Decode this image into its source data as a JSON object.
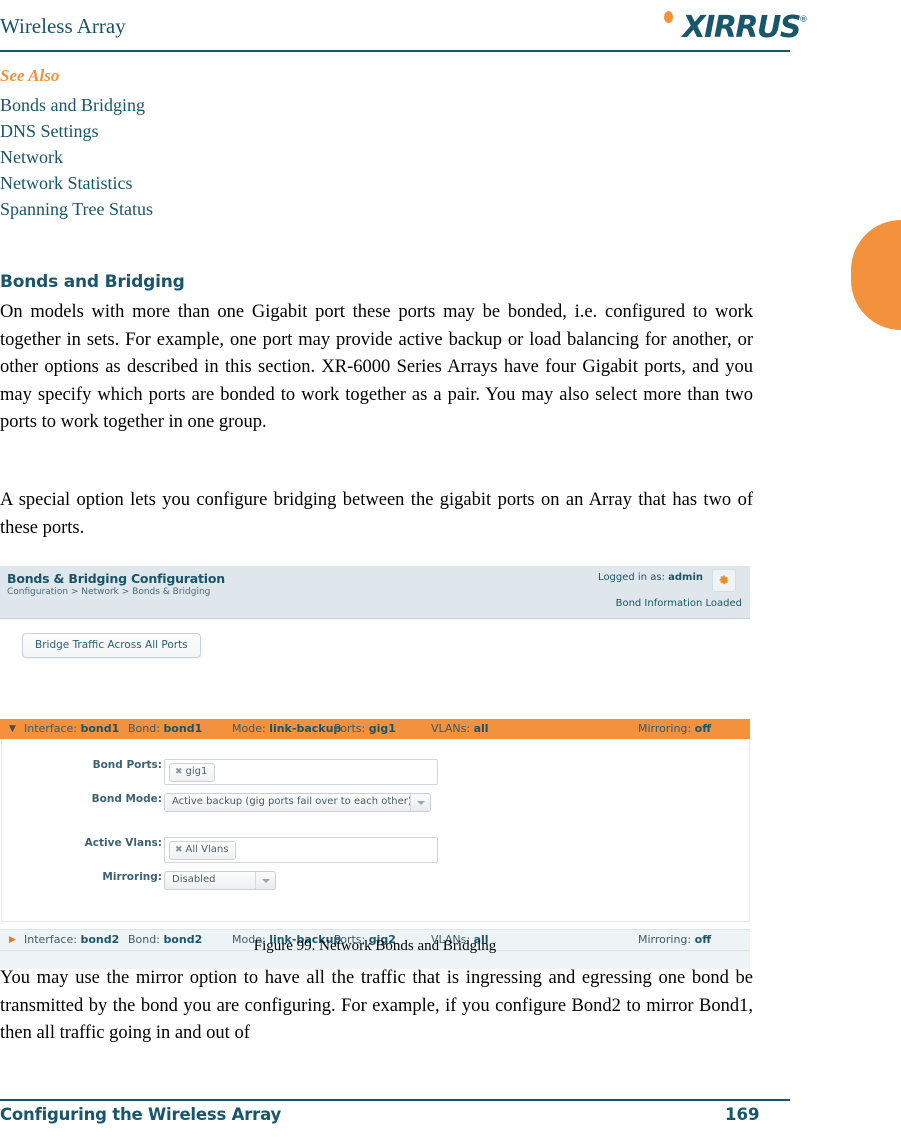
{
  "page_header": {
    "title": "Wireless Array",
    "logo_text": "XIRRUS",
    "logo_registered": "®"
  },
  "see_also": {
    "title": "See Also",
    "links": [
      "Bonds and Bridging",
      "DNS Settings",
      "Network",
      "Network Statistics",
      "Spanning Tree Status"
    ]
  },
  "section": {
    "heading": "Bonds and Bridging",
    "paragraph_1": "On models with more than one Gigabit port these ports may be bonded, i.e. configured to work together in sets. For example, one port may provide active backup or load balancing for another, or other options as described in this section. XR-6000 Series Arrays have four Gigabit ports, and you may specify which ports are bonded to work together as a pair. You may also select more than two ports to work together in one group.",
    "paragraph_2": "A special option lets you configure bridging between the gigabit ports on an Array that has two of these ports.",
    "paragraph_3": "You may use the mirror option to have all the traffic that is ingressing and egressing one bond be transmitted by the bond you are configuring. For example, if you configure Bond2 to mirror Bond1, then all traffic going in and out of"
  },
  "figure": {
    "caption": "Figure 99. Network Bonds and Bridging"
  },
  "ui": {
    "title": "Bonds & Bridging Configuration",
    "breadcrumb": "Configuration > Network > Bonds & Bridging",
    "logged_in_label": "Logged in as:",
    "logged_in_user": "admin",
    "gear_icon": "gear-icon",
    "status": "Bond Information Loaded",
    "bridge_button": "Bridge Traffic Across All Ports",
    "rows": [
      {
        "expanded": true,
        "triangle": "▼",
        "interface_label": "Interface:",
        "interface_value": "bond1",
        "bond_label": "Bond:",
        "bond_value": "bond1",
        "mode_label": "Mode:",
        "mode_value": "link-backup",
        "ports_label": "Ports:",
        "ports_value": "gig1",
        "vlans_label": "VLANs:",
        "vlans_value": "all",
        "mirroring_label": "Mirroring:",
        "mirroring_value": "off"
      },
      {
        "expanded": false,
        "triangle": "▶",
        "interface_label": "Interface:",
        "interface_value": "bond2",
        "bond_label": "Bond:",
        "bond_value": "bond2",
        "mode_label": "Mode:",
        "mode_value": "link-backup",
        "ports_label": "Ports:",
        "ports_value": "gig2",
        "vlans_label": "VLANs:",
        "vlans_value": "all",
        "mirroring_label": "Mirroring:",
        "mirroring_value": "off"
      }
    ],
    "form": {
      "bond_ports_label": "Bond Ports:",
      "bond_ports_token": "gig1",
      "bond_mode_label": "Bond Mode:",
      "bond_mode_value": "Active backup (gig ports fail over to each other)",
      "active_vlans_label": "Active Vlans:",
      "active_vlans_token": "All Vlans",
      "mirroring_label": "Mirroring:",
      "mirroring_value": "Disabled",
      "remove_token_icon": "✖"
    }
  },
  "footer": {
    "left": "Configuring the Wireless Array",
    "page_number": "169"
  },
  "colors": {
    "brand_teal": "#19556b",
    "accent_orange": "#f4913c",
    "ui_header_bg": "#dfe7ec",
    "ui_row_light": "#eef4f6"
  }
}
